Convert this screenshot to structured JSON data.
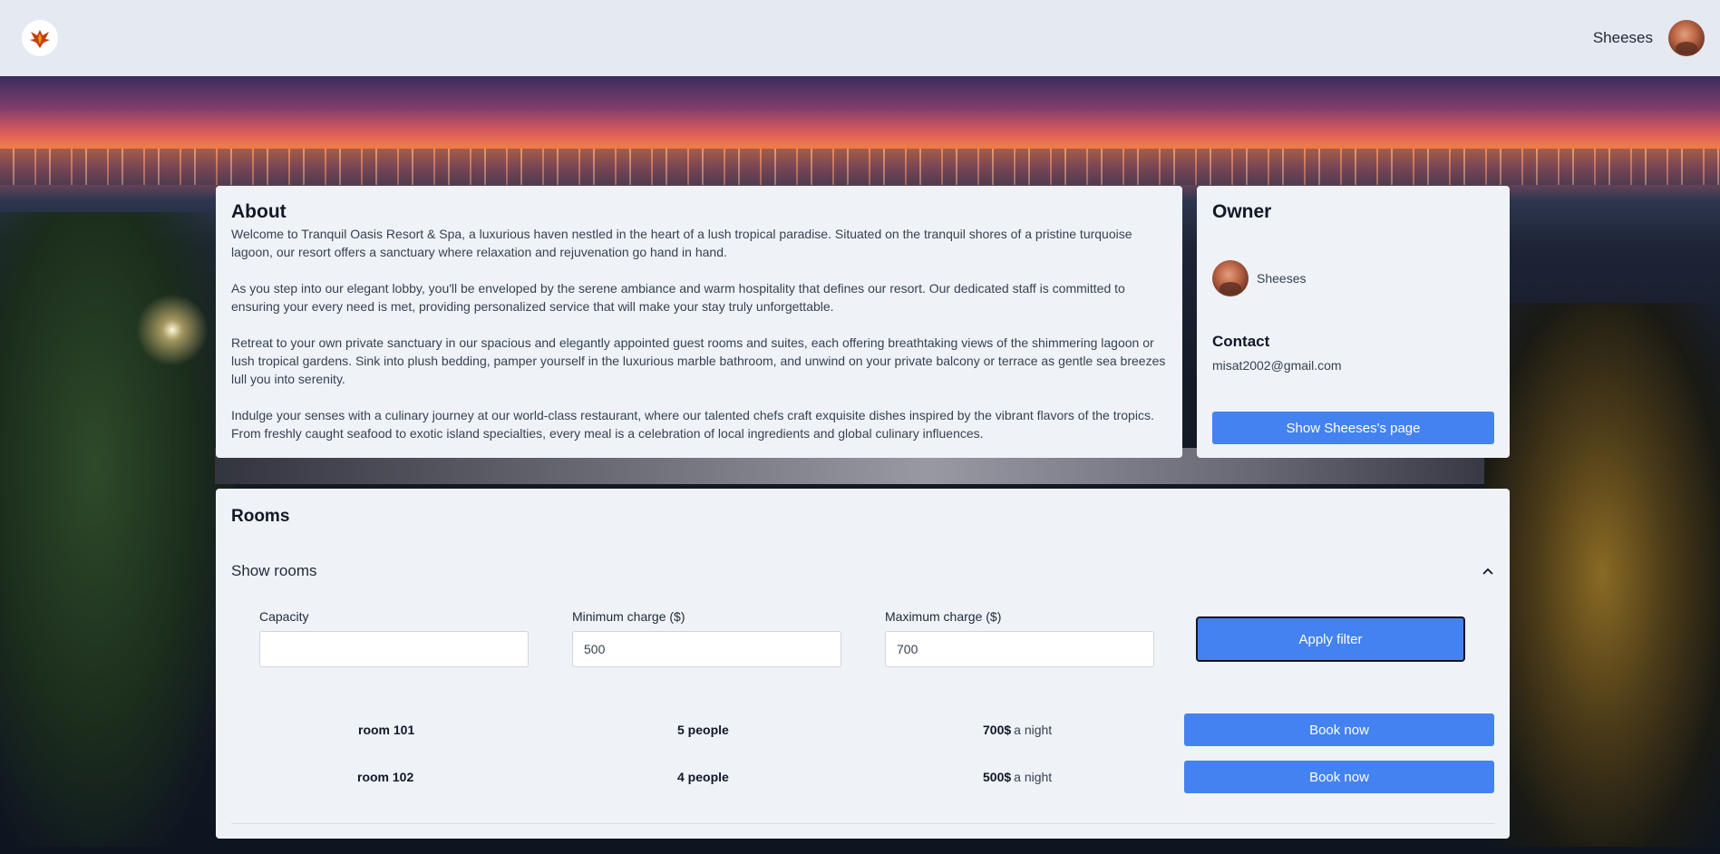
{
  "header": {
    "user_name": "Sheeses"
  },
  "about": {
    "title": "About",
    "paragraphs": [
      "Welcome to Tranquil Oasis Resort & Spa, a luxurious haven nestled in the heart of a lush tropical paradise. Situated on the tranquil shores of a pristine turquoise lagoon, our resort offers a sanctuary where relaxation and rejuvenation go hand in hand.",
      "As you step into our elegant lobby, you'll be enveloped by the serene ambiance and warm hospitality that defines our resort. Our dedicated staff is committed to ensuring your every need is met, providing personalized service that will make your stay truly unforgettable.",
      "Retreat to your own private sanctuary in our spacious and elegantly appointed guest rooms and suites, each offering breathtaking views of the shimmering lagoon or lush tropical gardens. Sink into plush bedding, pamper yourself in the luxurious marble bathroom, and unwind on your private balcony or terrace as gentle sea breezes lull you into serenity.",
      "Indulge your senses with a culinary journey at our world-class restaurant, where our talented chefs craft exquisite dishes inspired by the vibrant flavors of the tropics. From freshly caught seafood to exotic island specialties, every meal is a celebration of local ingredients and global culinary influences."
    ]
  },
  "owner": {
    "title": "Owner",
    "name": "Sheeses",
    "contact_title": "Contact",
    "email": "misat2002@gmail.com",
    "page_button": "Show Sheeses's page"
  },
  "rooms": {
    "title": "Rooms",
    "toggle_label": "Show rooms",
    "expanded": true,
    "filters": {
      "capacity_label": "Capacity",
      "capacity_value": "",
      "min_label": "Minimum charge ($)",
      "min_value": "500",
      "max_label": "Maximum charge ($)",
      "max_value": "700",
      "apply_label": "Apply filter"
    },
    "list": [
      {
        "name": "room 101",
        "capacity": "5 people",
        "price": "700$",
        "unit": "a night",
        "book_label": "Book now"
      },
      {
        "name": "room 102",
        "capacity": "4 people",
        "price": "500$",
        "unit": "a night",
        "book_label": "Book now"
      }
    ]
  },
  "colors": {
    "primary": "#4382f0",
    "card_bg": "#eff3f8",
    "header_bg": "#e5e9f1"
  },
  "icons": {
    "logo": "phoenix-logo-icon",
    "avatar": "user-avatar",
    "chevron": "chevron-up-icon"
  }
}
